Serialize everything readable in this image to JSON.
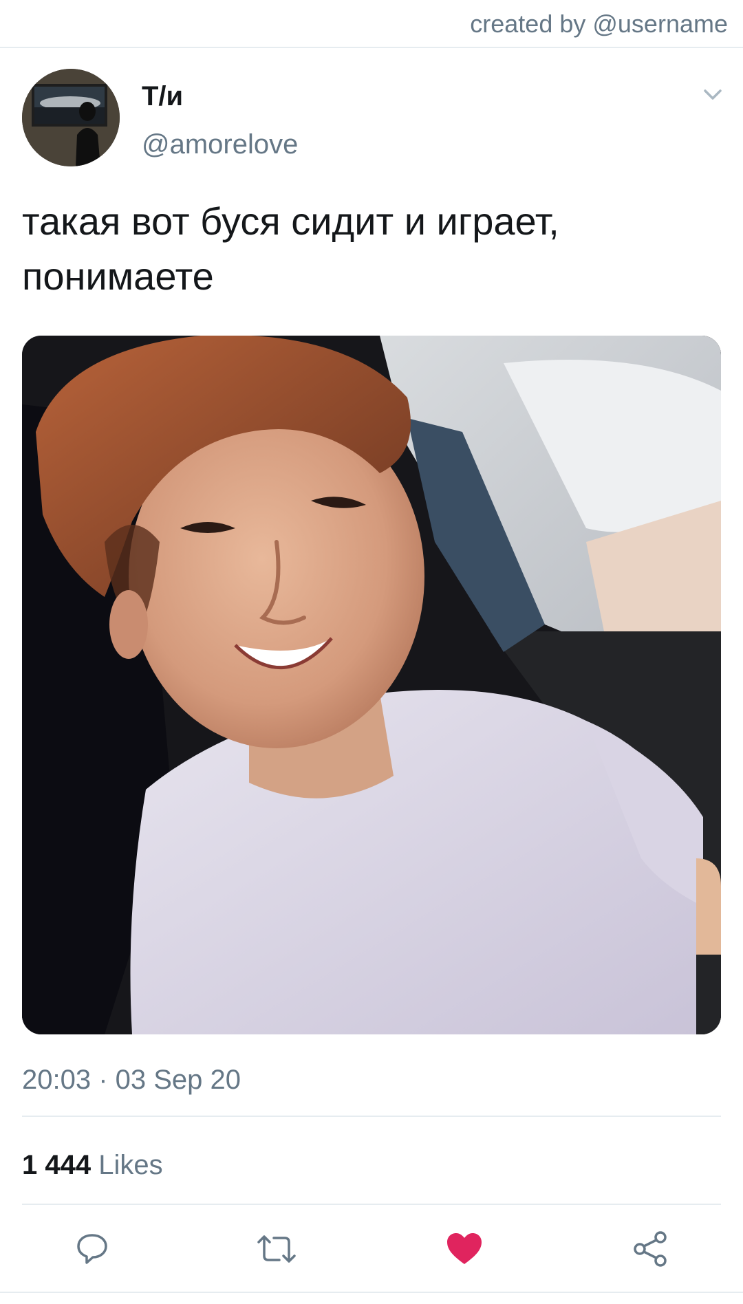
{
  "header": {
    "created_by": "created by @username"
  },
  "author": {
    "display_name": "Т/и",
    "handle": "@amorelove"
  },
  "tweet": {
    "text": "такая вот буся сидит и играет, понимаете",
    "timestamp": "20:03 · 03 Sep 20"
  },
  "stats": {
    "likes_count": "1 444",
    "likes_label": "Likes"
  },
  "actions": {
    "reply_icon": "reply-bubble-icon",
    "retweet_icon": "retweet-arrows-icon",
    "like_icon": "heart-icon",
    "share_icon": "share-nodes-icon"
  },
  "colors": {
    "text_primary": "#14171a",
    "text_secondary": "#657786",
    "divider": "#e6ecf0",
    "like_active": "#e0245e"
  }
}
